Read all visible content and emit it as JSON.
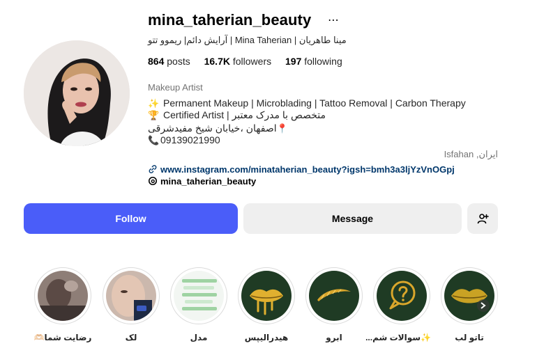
{
  "profile": {
    "username": "mina_taherian_beauty",
    "full_name": "مینا طاهریان | Mina Taherian | آرایش دائم| ریموو تتو",
    "stats": {
      "posts_count": "864",
      "posts_label": "posts",
      "followers_count": "16.7K",
      "followers_label": "followers",
      "following_count": "197",
      "following_label": "following"
    },
    "category": "Makeup Artist",
    "bio": [
      {
        "emoji": "✨",
        "text": "Permanent Makeup | Microblading | Tattoo Removal | Carbon Therapy"
      },
      {
        "emoji": "🏆",
        "text": "Certified Artist | متخصص با مدرک معتبر"
      },
      {
        "emoji": "📍",
        "text": "اصفهان ،خیابان شیخ مفیدشرقی"
      },
      {
        "emoji": "📞",
        "text": "09139021990"
      }
    ],
    "location": "Isfahan ,ایران",
    "link": "www.instagram.com/minataherian_beauty?igsh=bmh3a3ljYzVnOGpj",
    "threads_handle": "mina_taherian_beauty"
  },
  "actions": {
    "follow_label": "Follow",
    "message_label": "Message",
    "add_user_icon": "person-add-icon",
    "more_icon": "more-horizontal-icon"
  },
  "highlights": [
    {
      "label": "رضایت شما🫶🏻",
      "icon": "photo"
    },
    {
      "label": "لک",
      "icon": "photo"
    },
    {
      "label": "مدل",
      "icon": "photo"
    },
    {
      "label": "هیدرالیپس",
      "icon": "lips-gold"
    },
    {
      "label": "ابرو",
      "icon": "eyebrow-gold"
    },
    {
      "label": "✨سوالات شم...",
      "icon": "question-bubble"
    },
    {
      "label": "تاتو لب",
      "icon": "lips-print"
    }
  ],
  "colors": {
    "follow_button": "#4a5df9",
    "secondary_button": "#efefef",
    "link": "#00376b",
    "highlight_green": "#1f3b24",
    "gold": "#d9a62b"
  }
}
